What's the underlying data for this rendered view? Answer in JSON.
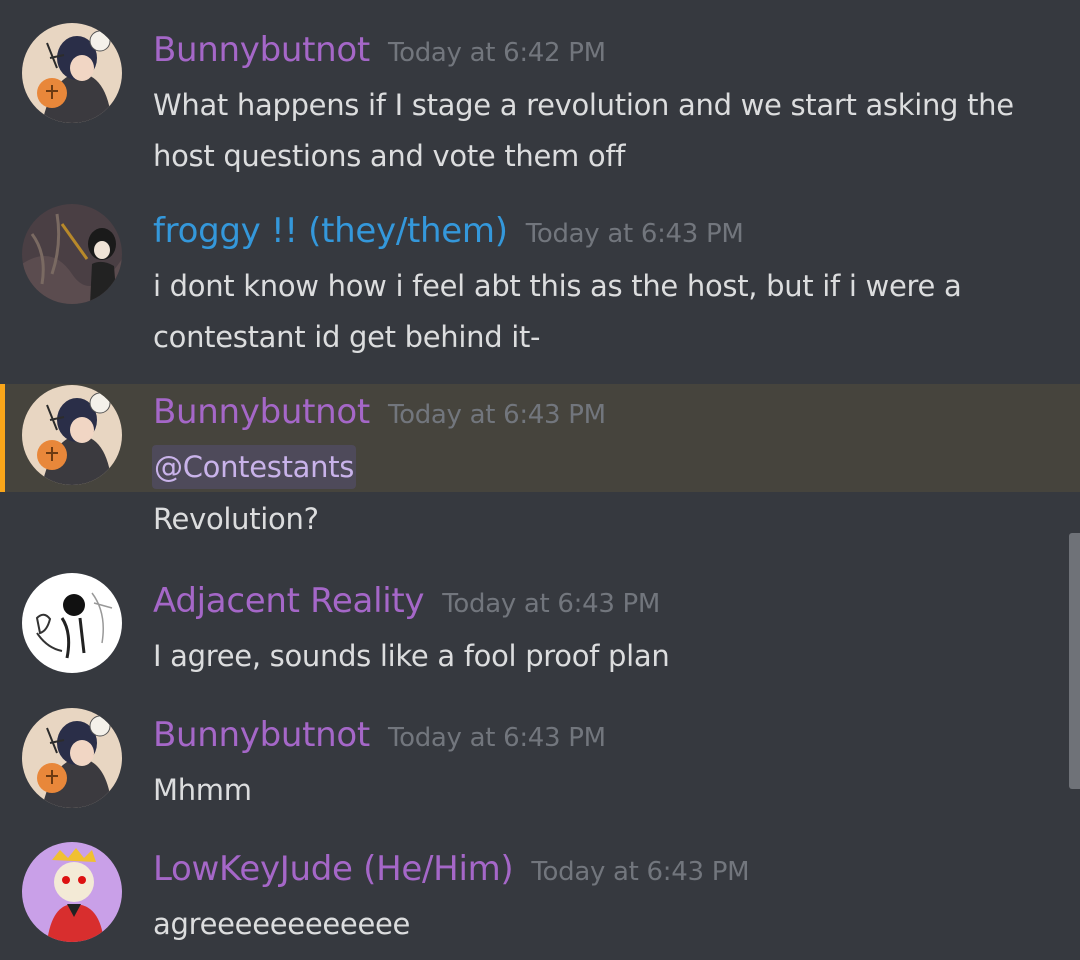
{
  "messages": [
    {
      "username": "Bunnybutnot",
      "username_color": "#a567c8",
      "timestamp": "Today at 6:42 PM",
      "avatar": "bunny-avatar-icon",
      "lines": [
        "What happens if I stage a revolution and we start asking the",
        "host questions and vote them off"
      ]
    },
    {
      "username": "froggy !! (they/them)",
      "username_color": "#3498db",
      "timestamp": "Today at 6:43 PM",
      "avatar": "froggy-avatar-icon",
      "lines": [
        "i dont know how i feel abt this as the host, but if i were a",
        "contestant id get behind it-"
      ]
    },
    {
      "username": "Bunnybutnot",
      "username_color": "#a567c8",
      "timestamp": "Today at 6:43 PM",
      "avatar": "bunny-avatar-icon",
      "mention": "@Contestants",
      "lines": [
        "Revolution?"
      ],
      "highlight_color": "#faa61a"
    },
    {
      "username": "Adjacent Reality",
      "username_color": "#a567c8",
      "timestamp": "Today at 6:43 PM",
      "avatar": "sketch-avatar-icon",
      "lines": [
        "I agree, sounds like a fool proof plan"
      ]
    },
    {
      "username": "Bunnybutnot",
      "username_color": "#a567c8",
      "timestamp": "Today at 6:43 PM",
      "avatar": "bunny-avatar-icon",
      "lines": [
        "Mhmm"
      ]
    },
    {
      "username": "LowKeyJude (He/Him)",
      "username_color": "#a567c8",
      "timestamp": "Today at 6:43 PM",
      "avatar": "jude-avatar-icon",
      "lines": [
        "agreeeeeeeeeeee"
      ]
    }
  ]
}
